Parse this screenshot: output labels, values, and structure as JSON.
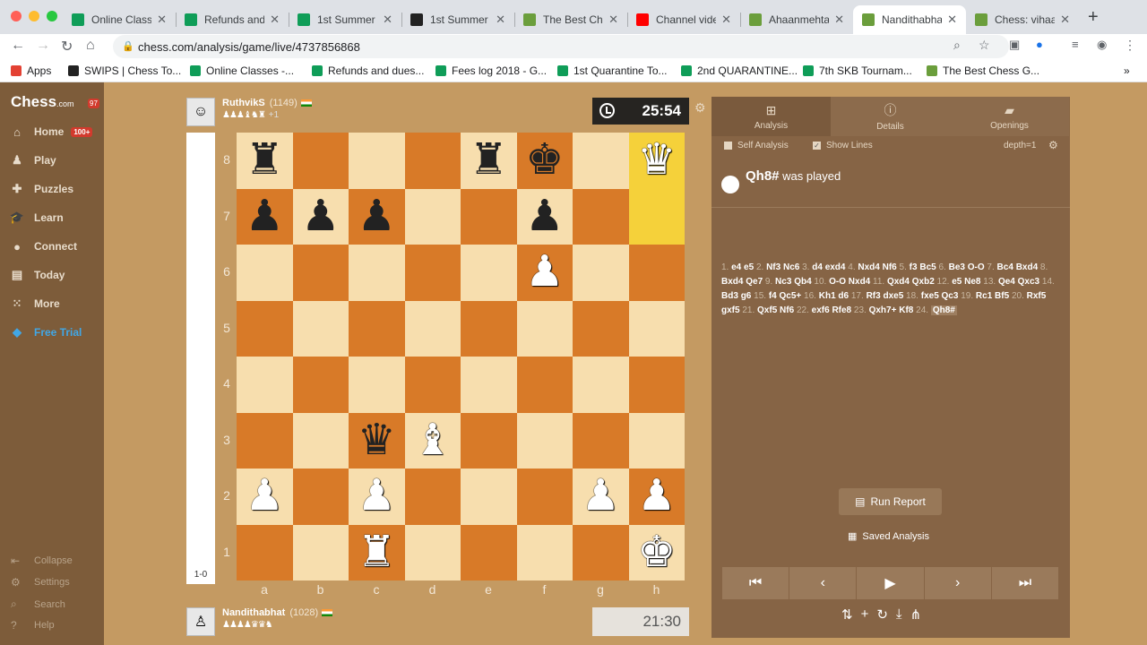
{
  "browser": {
    "tabs": [
      {
        "title": "Online Classe",
        "icon": "sheets-icon"
      },
      {
        "title": "Refunds and",
        "icon": "sheets-icon"
      },
      {
        "title": "1st Summer T",
        "icon": "sheets-icon"
      },
      {
        "title": "1st Summer T",
        "icon": "chess-king-icon"
      },
      {
        "title": "The Best Che",
        "icon": "chess-pawn-icon"
      },
      {
        "title": "Channel vide",
        "icon": "youtube-icon"
      },
      {
        "title": "Ahaanmehta",
        "icon": "chess-pawn-icon"
      },
      {
        "title": "Nandithabhat",
        "icon": "chess-pawn-icon"
      },
      {
        "title": "Chess: vihaa",
        "icon": "chess-pawn-icon"
      }
    ],
    "active_tab": 7,
    "url": "chess.com/analysis/game/live/4737856868",
    "bookmarks": [
      {
        "label": "Apps"
      },
      {
        "label": "SWIPS | Chess To..."
      },
      {
        "label": "Online Classes -..."
      },
      {
        "label": "Refunds and dues..."
      },
      {
        "label": "Fees log 2018 - G..."
      },
      {
        "label": "1st Quarantine To..."
      },
      {
        "label": "2nd QUARANTINE..."
      },
      {
        "label": "7th SKB Tournam..."
      },
      {
        "label": "The Best Chess G..."
      }
    ]
  },
  "sidebar": {
    "logo": "Chess",
    "logo_suffix": ".com",
    "logo_badge": "97",
    "items": [
      {
        "label": "Home",
        "badge": "100+"
      },
      {
        "label": "Play"
      },
      {
        "label": "Puzzles"
      },
      {
        "label": "Learn"
      },
      {
        "label": "Connect"
      },
      {
        "label": "Today"
      },
      {
        "label": "More"
      },
      {
        "label": "Free Trial"
      }
    ],
    "footer": [
      {
        "label": "Collapse"
      },
      {
        "label": "Settings"
      },
      {
        "label": "Search"
      },
      {
        "label": "Help"
      }
    ]
  },
  "top_player": {
    "name": "RuthvikS",
    "rating": "(1149)",
    "captured": "♟♟♟♝♞♜",
    "advantage": "+1",
    "clock": "25:54"
  },
  "bottom_player": {
    "name": "Nandithabhat",
    "rating": "(1028)",
    "captured": "♟♟♟♟♛♛♞",
    "clock": "21:30"
  },
  "eval": "1-0",
  "ranks": [
    "8",
    "7",
    "6",
    "5",
    "4",
    "3",
    "2",
    "1"
  ],
  "files": [
    "a",
    "b",
    "c",
    "d",
    "e",
    "f",
    "g",
    "h"
  ],
  "pieces": [
    {
      "sq": "a8",
      "p": "♜",
      "c": "b"
    },
    {
      "sq": "e8",
      "p": "♜",
      "c": "b"
    },
    {
      "sq": "f8",
      "p": "♚",
      "c": "b"
    },
    {
      "sq": "h8",
      "p": "♛",
      "c": "w"
    },
    {
      "sq": "a7",
      "p": "♟",
      "c": "b"
    },
    {
      "sq": "b7",
      "p": "♟",
      "c": "b"
    },
    {
      "sq": "c7",
      "p": "♟",
      "c": "b"
    },
    {
      "sq": "f7",
      "p": "♟",
      "c": "b"
    },
    {
      "sq": "f6",
      "p": "♟",
      "c": "w"
    },
    {
      "sq": "c3",
      "p": "♛",
      "c": "b"
    },
    {
      "sq": "d3",
      "p": "♝",
      "c": "w"
    },
    {
      "sq": "a2",
      "p": "♟",
      "c": "w"
    },
    {
      "sq": "c2",
      "p": "♟",
      "c": "w"
    },
    {
      "sq": "g2",
      "p": "♟",
      "c": "w"
    },
    {
      "sq": "h2",
      "p": "♟",
      "c": "w"
    },
    {
      "sq": "c1",
      "p": "♜",
      "c": "w"
    },
    {
      "sq": "h1",
      "p": "♚",
      "c": "w"
    }
  ],
  "highlight": [
    "h8",
    "h7"
  ],
  "panel": {
    "tabs": [
      {
        "label": "Analysis"
      },
      {
        "label": "Details"
      },
      {
        "label": "Openings"
      }
    ],
    "self_analysis": "Self Analysis",
    "show_lines": "Show Lines",
    "depth": "depth=1",
    "last_move": "Qh8#",
    "last_move_suffix": "was played",
    "moves": [
      [
        "e4",
        "e5"
      ],
      [
        "Nf3",
        "Nc6"
      ],
      [
        "d4",
        "exd4"
      ],
      [
        "Nxd4",
        "Nf6"
      ],
      [
        "f3",
        "Bc5"
      ],
      [
        "Be3",
        "O-O"
      ],
      [
        "Bc4",
        "Bxd4"
      ],
      [
        "Bxd4",
        "Qe7"
      ],
      [
        "Nc3",
        "Qb4"
      ],
      [
        "O-O",
        "Nxd4"
      ],
      [
        "Qxd4",
        "Qxb2"
      ],
      [
        "e5",
        "Ne8"
      ],
      [
        "Qe4",
        "Qxc3"
      ],
      [
        "Bd3",
        "g6"
      ],
      [
        "f4",
        "Qc5+"
      ],
      [
        "Kh1",
        "d6"
      ],
      [
        "Rf3",
        "dxe5"
      ],
      [
        "fxe5",
        "Qc3"
      ],
      [
        "Rc1",
        "Bf5"
      ],
      [
        "Rxf5",
        "gxf5"
      ],
      [
        "Qxf5",
        "Nf6"
      ],
      [
        "exf6",
        "Rfe8"
      ],
      [
        "Qxh7+",
        "Kf8"
      ],
      [
        "Qh8#"
      ]
    ],
    "run_report": "Run Report",
    "saved_analysis": "Saved Analysis"
  }
}
